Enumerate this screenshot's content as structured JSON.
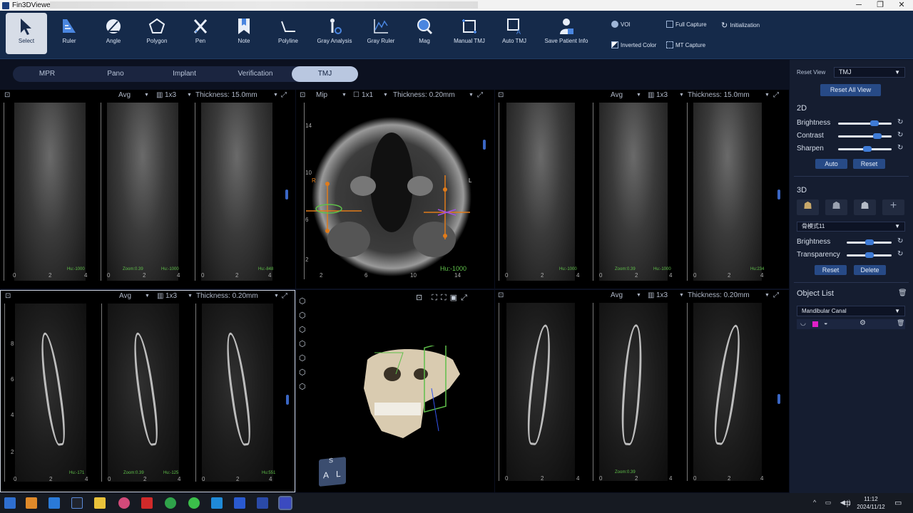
{
  "window": {
    "title": "Fin3DViewer",
    "controls": [
      "─",
      "❐",
      "✕"
    ]
  },
  "toolbar": {
    "tools": [
      {
        "label": "Select",
        "icon": "pointer-icon",
        "active": true
      },
      {
        "label": "Ruler",
        "icon": "ruler-icon"
      },
      {
        "label": "Angle",
        "icon": "angle-icon"
      },
      {
        "label": "Polygon",
        "icon": "polygon-icon"
      },
      {
        "label": "Pen",
        "icon": "pen-icon"
      },
      {
        "label": "Note",
        "icon": "note-icon"
      },
      {
        "label": "Polyline",
        "icon": "polyline-icon"
      },
      {
        "label": "Gray Analysis",
        "icon": "gray-analysis-icon"
      },
      {
        "label": "Gray Ruler",
        "icon": "gray-ruler-icon"
      },
      {
        "label": "Mag",
        "icon": "magnifier-icon"
      },
      {
        "label": "Manual TMJ",
        "icon": "manual-tmj-icon"
      },
      {
        "label": "Auto TMJ",
        "icon": "auto-tmj-icon"
      },
      {
        "label": "Save Patient Info",
        "icon": "patient-icon"
      }
    ],
    "small": {
      "voi": "VOI",
      "inverted": "Inverted Color",
      "full_capture": "Full Capture",
      "mt_capture": "MT Capture",
      "initialization": "Initialization"
    }
  },
  "tabs": [
    "MPR",
    "Pano",
    "Implant",
    "Verification",
    "TMJ"
  ],
  "active_tab": "TMJ",
  "panels": {
    "top_left": {
      "mode": "Avg",
      "layout": "1x3",
      "thickness": "Thickness: 15.0mm",
      "hu": [
        "Hu:-1000",
        "Hu:-1000",
        "Hu:-848"
      ],
      "zoom": "Zoom:0.39"
    },
    "top_center": {
      "mode": "Mip",
      "layout": "1x1",
      "thickness": "Thickness: 0.20mm",
      "hu": "Hu:-1000",
      "left_marker": "R",
      "right_marker": "L"
    },
    "top_right": {
      "mode": "Avg",
      "layout": "1x3",
      "thickness": "Thickness: 15.0mm",
      "hu": [
        "Hu:-1000",
        "Hu:-1000",
        "Hu:234"
      ],
      "zoom": "Zoom:0.39"
    },
    "bottom_left": {
      "mode": "Avg",
      "layout": "1x3",
      "thickness": "Thickness: 0.20mm",
      "hu": [
        "Hu:-171",
        "Hu:-125",
        "Hu:551"
      ],
      "zoom": "Zoom:0.39"
    },
    "bottom_right": {
      "mode": "Avg",
      "layout": "1x3",
      "thickness": "Thickness: 0.20mm",
      "zoom": "Zoom:0.39"
    },
    "cube": {
      "top": "S",
      "left": "A",
      "right": "L"
    }
  },
  "rulers": {
    "vertical": [
      "10",
      "8",
      "6",
      "4",
      "2",
      "0"
    ],
    "horizontal": [
      "0",
      "2",
      "4"
    ],
    "axial_vertical": [
      "16",
      "14",
      "12",
      "10",
      "8",
      "6",
      "4",
      "2"
    ],
    "axial_horizontal": [
      "2",
      "4",
      "6",
      "8",
      "10",
      "12",
      "14",
      "1"
    ]
  },
  "right_panel": {
    "reset_view_label": "Reset View",
    "reset_view_value": "TMJ",
    "reset_all": "Reset All View",
    "section_2d": "2D",
    "brightness": "Brightness",
    "contrast": "Contrast",
    "sharpen": "Sharpen",
    "auto": "Auto",
    "reset": "Reset",
    "section_3d": "3D",
    "preset_value": "骨模式11",
    "brightness_3d": "Brightness",
    "transparency": "Transparency",
    "reset_3d": "Reset",
    "delete": "Delete",
    "object_list": "Object List",
    "object_value": "Mandibular Canal",
    "levels": {
      "brightness": 0.68,
      "contrast": 0.73,
      "sharpen": 0.55,
      "brightness_3d": 0.5,
      "transparency": 0.5
    }
  },
  "taskbar": {
    "time": "11:12",
    "date": "2024/11/12",
    "ime": "中"
  },
  "colors": {
    "accent": "#3f7bd6",
    "toolbar": "#152a4a",
    "hu_text": "#5fc04a",
    "object_color": "#e020c8"
  }
}
